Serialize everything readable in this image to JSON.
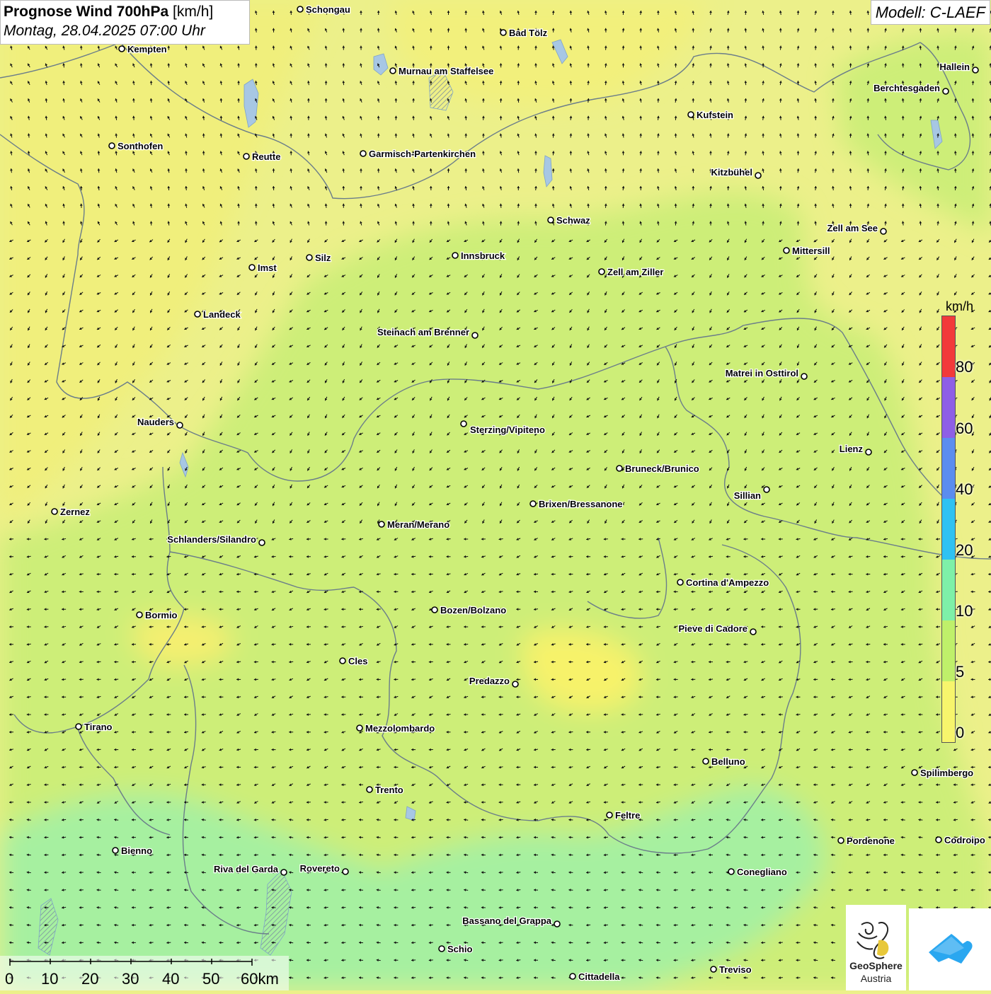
{
  "header": {
    "title_main": "Prognose Wind 700hPa",
    "title_unit": "[km/h]",
    "datetime": "Montag, 28.04.2025 07:00 Uhr",
    "model": "Modell: C-LAEF"
  },
  "legend": {
    "unit": "km/h",
    "labels": [
      "80",
      "60",
      "40",
      "20",
      "10",
      "5",
      "0"
    ],
    "colors": [
      "#f23a3a",
      "#8e5fe6",
      "#5b8def",
      "#2fc2f2",
      "#7ef0a8",
      "#bff06a",
      "#f7f56c"
    ]
  },
  "scale_bar": {
    "labels": [
      "0",
      "10",
      "20",
      "30",
      "40",
      "50",
      "60km"
    ]
  },
  "logos": {
    "geosphere_line1": "GeoSphere",
    "geosphere_line2": "Austria"
  },
  "cities": [
    {
      "name": "Schongau"
    },
    {
      "name": "Bad Tölz"
    },
    {
      "name": "Kempten"
    },
    {
      "name": "Murnau am Staffelsee"
    },
    {
      "name": "Hallein"
    },
    {
      "name": "Berchtesgaden"
    },
    {
      "name": "Kufstein"
    },
    {
      "name": "Sonthofen"
    },
    {
      "name": "Reutte"
    },
    {
      "name": "Garmisch-Partenkirchen"
    },
    {
      "name": "Kitzbühel"
    },
    {
      "name": "Schwaz"
    },
    {
      "name": "Zell am See"
    },
    {
      "name": "Mittersill"
    },
    {
      "name": "Innsbruck"
    },
    {
      "name": "Silz"
    },
    {
      "name": "Imst"
    },
    {
      "name": "Zell am Ziller"
    },
    {
      "name": "Landeck"
    },
    {
      "name": "Steinach am Brenner"
    },
    {
      "name": "Matrei in Osttirol"
    },
    {
      "name": "Nauders"
    },
    {
      "name": "Sterzing/Vipiteno"
    },
    {
      "name": "Lienz"
    },
    {
      "name": "Bruneck/Brunico"
    },
    {
      "name": "Sillian"
    },
    {
      "name": "Brixen/Bressanone"
    },
    {
      "name": "Zernez"
    },
    {
      "name": "Meran/Merano"
    },
    {
      "name": "Schlanders/Silandro"
    },
    {
      "name": "Cortina d'Ampezzo"
    },
    {
      "name": "Bozen/Bolzano"
    },
    {
      "name": "Bormio"
    },
    {
      "name": "Pieve di Cadore"
    },
    {
      "name": "Cles"
    },
    {
      "name": "Predazzo"
    },
    {
      "name": "Tirano"
    },
    {
      "name": "Mezzolombardo"
    },
    {
      "name": "Belluno"
    },
    {
      "name": "Spilimbergo"
    },
    {
      "name": "Trento"
    },
    {
      "name": "Feltre"
    },
    {
      "name": "Pordenone"
    },
    {
      "name": "Codroipo"
    },
    {
      "name": "Bienno"
    },
    {
      "name": "Riva del Garda"
    },
    {
      "name": "Rovereto"
    },
    {
      "name": "Conegliano"
    },
    {
      "name": "Bassano del Grappa"
    },
    {
      "name": "Schio"
    },
    {
      "name": "Treviso"
    },
    {
      "name": "Cittadella"
    }
  ]
}
